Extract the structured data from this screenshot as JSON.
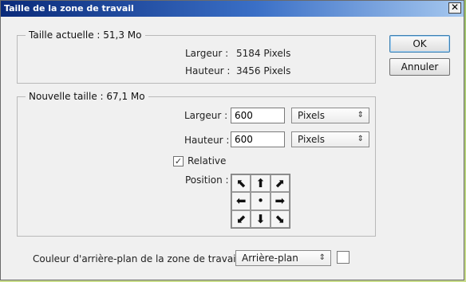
{
  "window": {
    "title": "Taille de la zone de travail",
    "close_glyph": "✕"
  },
  "current": {
    "legend": "Taille actuelle : 51,3 Mo",
    "width_label": "Largeur :",
    "width_value": "5184 Pixels",
    "height_label": "Hauteur :",
    "height_value": "3456 Pixels"
  },
  "new": {
    "legend": "Nouvelle taille : 67,1 Mo",
    "width_label": "Largeur :",
    "width_value": "600",
    "width_unit": "Pixels",
    "height_label": "Hauteur :",
    "height_value": "600",
    "height_unit": "Pixels",
    "relative_label": "Relative",
    "relative_checked": true,
    "position_label": "Position :",
    "anchor_glyphs": [
      "⬉",
      "⬆",
      "⬈",
      "⬅",
      "•",
      "➡",
      "⬋",
      "⬇",
      "⬊"
    ]
  },
  "buttons": {
    "ok": "OK",
    "cancel": "Annuler"
  },
  "background": {
    "label": "Couleur d'arrière-plan de la zone de travail :",
    "value": "Arrière-plan",
    "swatch_color": "#ffffff"
  },
  "glyphs": {
    "select_arrows": "⇕",
    "check": "✓"
  }
}
